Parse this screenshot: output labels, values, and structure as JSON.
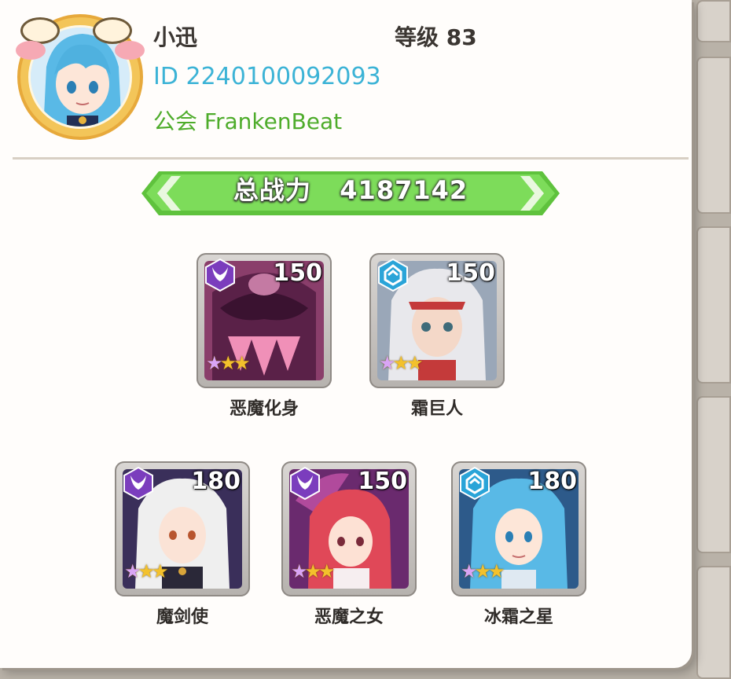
{
  "player": {
    "name": "小迅",
    "level_label": "等级 83",
    "id_label": "ID 2240100092093",
    "guild_label": "公会 FrankenBeat"
  },
  "power": {
    "label": "总战力",
    "value": "4187142"
  },
  "heroes": [
    {
      "name": "恶魔化身",
      "level": "150",
      "class_icon": "demon-horns-icon",
      "class_color": "#7b3dbd",
      "stars": 3
    },
    {
      "name": "霜巨人",
      "level": "150",
      "class_icon": "shield-crest-icon",
      "class_color": "#2aa4d8",
      "stars": 3
    },
    {
      "name": "魔剑使",
      "level": "180",
      "class_icon": "demon-horns-icon",
      "class_color": "#7b3dbd",
      "stars": 3
    },
    {
      "name": "恶魔之女",
      "level": "150",
      "class_icon": "demon-horns-icon",
      "class_color": "#7b3dbd",
      "stars": 3
    },
    {
      "name": "冰霜之星",
      "level": "180",
      "class_icon": "shield-crest-icon",
      "class_color": "#2aa4d8",
      "stars": 3
    }
  ],
  "colors": {
    "banner_green": "#6fd34f",
    "id_blue": "#3cb3d6",
    "guild_green": "#4eac2b",
    "avatar_gold": "#f3c559"
  }
}
